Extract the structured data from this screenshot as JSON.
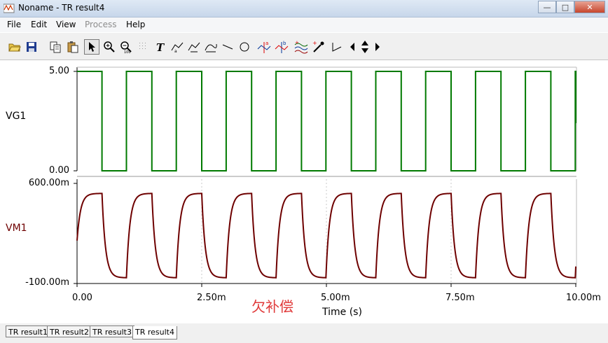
{
  "window": {
    "title": "Noname - TR result4"
  },
  "menu": [
    "File",
    "Edit",
    "View",
    "Process",
    "Help"
  ],
  "menu_disabled": [
    "Process"
  ],
  "toolbar": {
    "icons": [
      "open-icon",
      "save-icon",
      "copy-icon",
      "paste-icon",
      "pointer-icon",
      "zoom-in-icon",
      "zoom-out-icon",
      "zoom-100-icon",
      "grid-icon",
      "text-icon",
      "label-icon",
      "curve-label-icon",
      "curve-label-2-icon",
      "line-icon",
      "circle-icon",
      "cursor-a-icon",
      "cursor-b-icon",
      "waveform-icon",
      "probe-icon",
      "slope-icon",
      "arrow-left-icon",
      "arrow-up-down-icon",
      "arrow-right-icon"
    ]
  },
  "overlay_text": "欠补偿",
  "tabs": [
    "TR result1",
    "TR result2",
    "TR result3",
    "TR result4"
  ],
  "active_tab": "TR result4",
  "colors": {
    "vg1": "#007a00",
    "vm1": "#6e0000",
    "grid": "#c8c8c8"
  },
  "chart_data": [
    {
      "type": "line",
      "series": [
        {
          "name": "VG1",
          "waveform": "square",
          "low": 0.0,
          "high": 5.0
        }
      ],
      "y_tick_labels": [
        "5.00",
        "0.00"
      ],
      "ylim": [
        0.0,
        5.0
      ],
      "x_unit_label": "Time (s)",
      "edges_ms": [
        0.0,
        0.5,
        0.99,
        1.5,
        1.99,
        2.5,
        2.99,
        3.5,
        3.99,
        4.5,
        4.99,
        5.5,
        5.99,
        6.5,
        6.99,
        7.5,
        7.99,
        8.5,
        8.99,
        9.5,
        9.99
      ],
      "start_level": "high"
    },
    {
      "type": "line",
      "series": [
        {
          "name": "VM1",
          "waveform": "rc-filtered square",
          "low_mV": -60,
          "high_mV": 530,
          "start_mV": 200
        }
      ],
      "y_tick_labels": [
        "600.00m",
        "-100.00m"
      ],
      "ylim": [
        -0.1,
        0.6
      ],
      "x_tick_labels": [
        "0.00",
        "2.50m",
        "5.00m",
        "7.50m",
        "10.00m"
      ],
      "xlim": [
        0.0,
        0.01
      ],
      "xlabel": "Time (s)",
      "grid": "dotted vertical at x ticks"
    }
  ]
}
